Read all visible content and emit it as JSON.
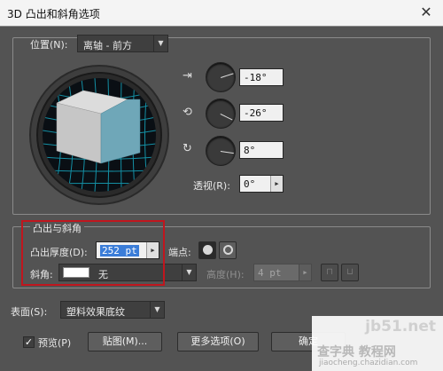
{
  "window": {
    "title": "3D 凸出和斜角选项"
  },
  "position": {
    "label": "位置(N):",
    "preset": "离轴 - 前方",
    "x_angle": "-18°",
    "y_angle": "-26°",
    "z_angle": "8°",
    "perspective_label": "透视(R):",
    "perspective_value": "0°"
  },
  "extrude": {
    "section_title": "凸出与斜角",
    "depth_label": "凸出厚度(D):",
    "depth_value": "252 pt",
    "cap_label": "端点:",
    "bevel_label": "斜角:",
    "bevel_value": "无",
    "height_label": "高度(H):",
    "height_value": "4 pt"
  },
  "surface": {
    "label": "表面(S):",
    "value": "塑料效果底纹"
  },
  "footer": {
    "preview_label": "预览(P)",
    "preview_checked": true,
    "map_button": "贴图(M)...",
    "more_button": "更多选项(O)",
    "ok_button": "确定"
  },
  "watermark": {
    "text": "jb51.net",
    "subtext": "查字典 教程网",
    "url": "jiaocheng.chazidian.com"
  },
  "colors": {
    "dialog_bg": "#535353",
    "cube_front": "#6fa7b8",
    "cube_top": "#d8d8d8",
    "cube_side": "#c9c9c9",
    "grid": "#17b0c8",
    "highlight": "#c0161e"
  }
}
